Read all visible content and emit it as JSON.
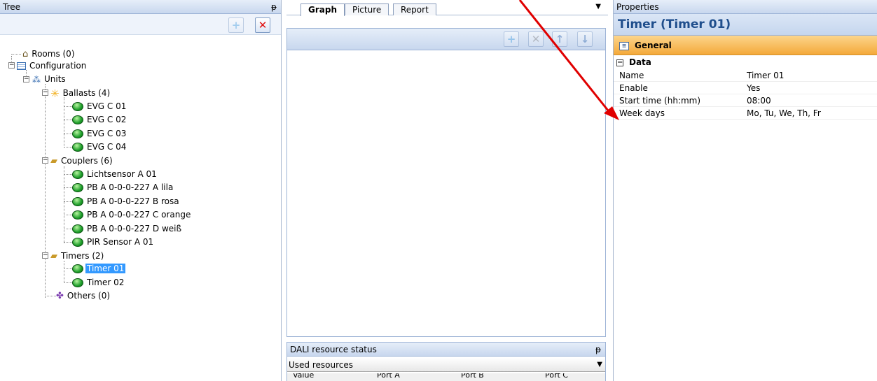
{
  "tree": {
    "title": "Tree",
    "pin": "ᵽ",
    "add_label": "+",
    "delete_label": "✕",
    "nodes": {
      "rooms": "Rooms (0)",
      "configuration": "Configuration",
      "units": "Units",
      "ballasts": "Ballasts (4)",
      "evg1": "EVG C 01",
      "evg2": "EVG C 02",
      "evg3": "EVG C 03",
      "evg4": "EVG C 04",
      "couplers": "Couplers (6)",
      "lichtsensor": "Lichtsensor A 01",
      "pb_a": "PB A 0-0-0-227 A lila",
      "pb_b": "PB A 0-0-0-227 B rosa",
      "pb_c": "PB A 0-0-0-227 C orange",
      "pb_d": "PB A 0-0-0-227 D weiß",
      "pir": "PIR Sensor A 01",
      "timers": "Timers (2)",
      "timer1": "Timer 01",
      "timer2": "Timer 02",
      "others": "Others (0)"
    }
  },
  "middle": {
    "tabs": [
      "Graph",
      "Picture",
      "Report"
    ],
    "tab_dropdown": "▼",
    "dali": {
      "title": "DALI resource status",
      "pin": "ᵽ",
      "selected": "Used resources",
      "arrow": "▼",
      "columns": [
        "Value",
        "Port A",
        "Port B",
        "Port C"
      ]
    }
  },
  "properties": {
    "header": "Properties",
    "title": "Timer (Timer 01)",
    "category": "General",
    "section": "Data",
    "collapse": "−",
    "rows": [
      {
        "key": "Name",
        "value": "Timer 01"
      },
      {
        "key": "Enable",
        "value": "Yes"
      },
      {
        "key": "Start time (hh:mm)",
        "value": "08:00"
      },
      {
        "key": "Week days",
        "value": "Mo, Tu, We, Th, Fr"
      }
    ]
  },
  "colors": {
    "accent": "#1f4e8c",
    "selection": "#3399ff",
    "general_band": "#f4a93a",
    "annotation_arrow": "#e00000"
  }
}
